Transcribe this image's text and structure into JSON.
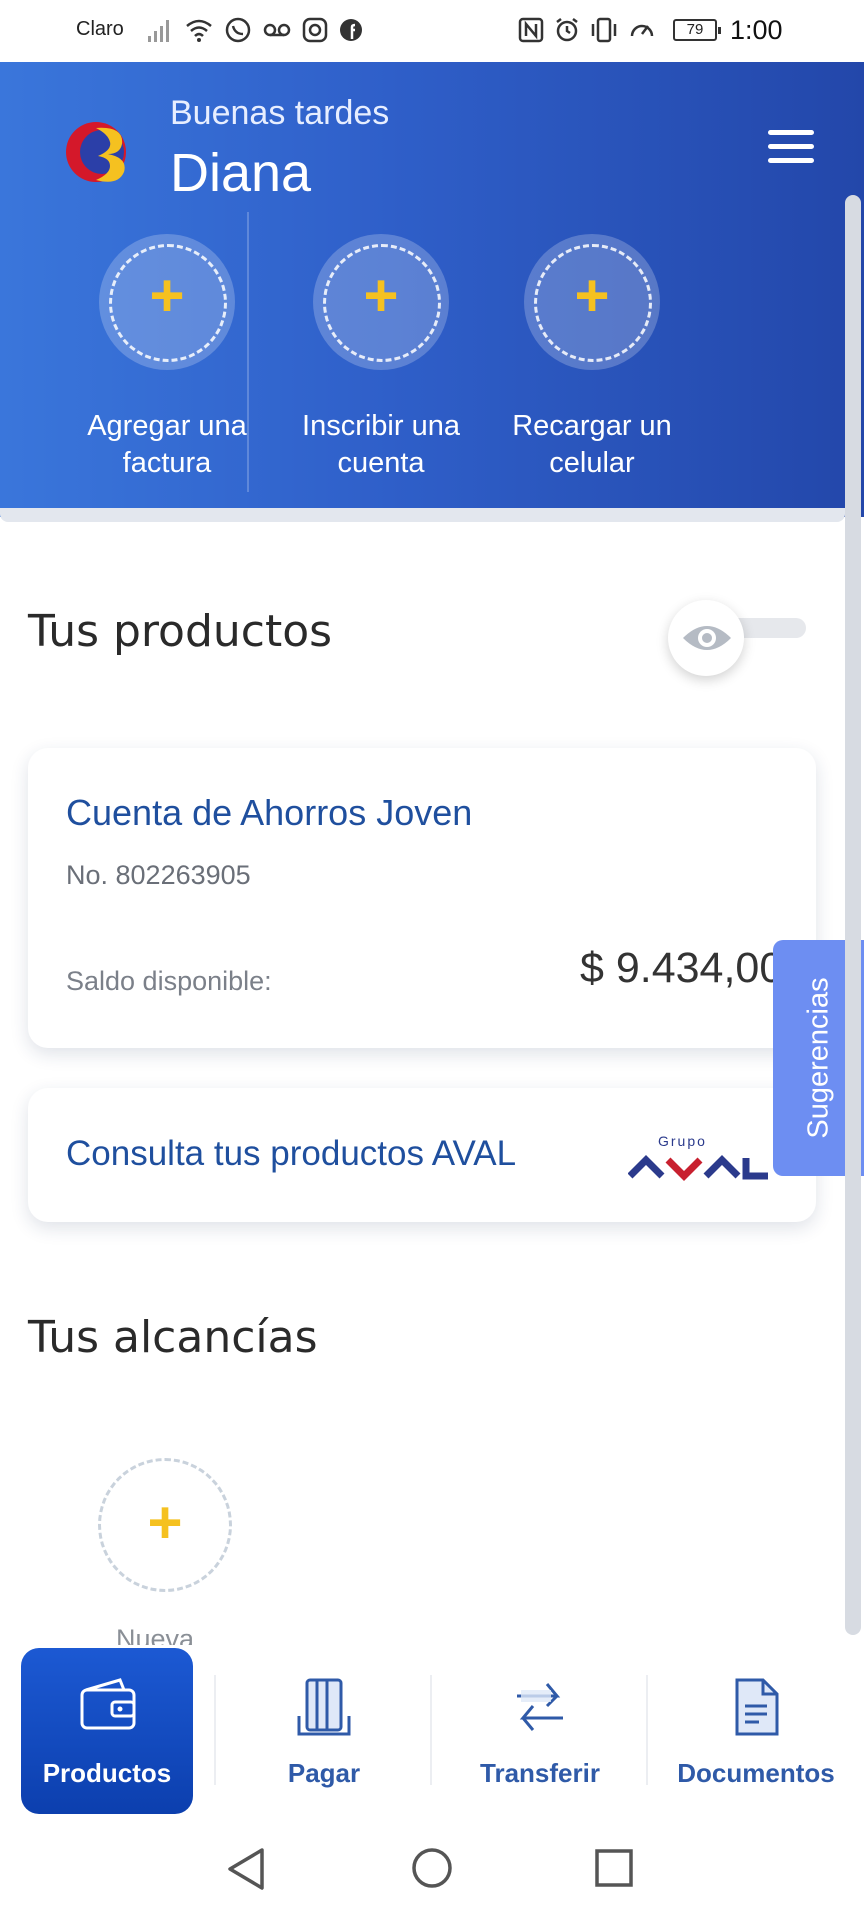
{
  "status_bar": {
    "carrier": "Claro",
    "battery": "79",
    "time": "1:00"
  },
  "header": {
    "greeting": "Buenas tardes",
    "user_name": "Diana",
    "quick_actions": [
      {
        "line1": "Agregar una",
        "line2": "factura"
      },
      {
        "line1": "Inscribir una",
        "line2": "cuenta"
      },
      {
        "line1": "Recargar un",
        "line2": "celular"
      }
    ],
    "plus_symbol": "+"
  },
  "products": {
    "title": "Tus productos",
    "account": {
      "name": "Cuenta de Ahorros Joven",
      "number": "No. 802263905",
      "balance_label": "Saldo disponible:",
      "balance": "$ 9.434,00"
    },
    "aval": {
      "text": "Consulta tus productos AVAL",
      "logo_small": "Grupo",
      "logo_big": "AVAL"
    }
  },
  "piggy_banks": {
    "title": "Tus alcancías",
    "new_label": "Nueva"
  },
  "suggestions_tab": "Sugerencias",
  "bottom_nav": [
    {
      "label": "Productos",
      "icon": "wallet-icon",
      "active": true
    },
    {
      "label": "Pagar",
      "icon": "card-pay-icon",
      "active": false
    },
    {
      "label": "Transferir",
      "icon": "transfer-arrows-icon",
      "active": false
    },
    {
      "label": "Documentos",
      "icon": "document-icon",
      "active": false
    }
  ],
  "colors": {
    "header_blue": "#2f5fc9",
    "accent_yellow": "#f5c120",
    "link_blue": "#1f4f9e",
    "suggestions": "#6d8ef2"
  }
}
